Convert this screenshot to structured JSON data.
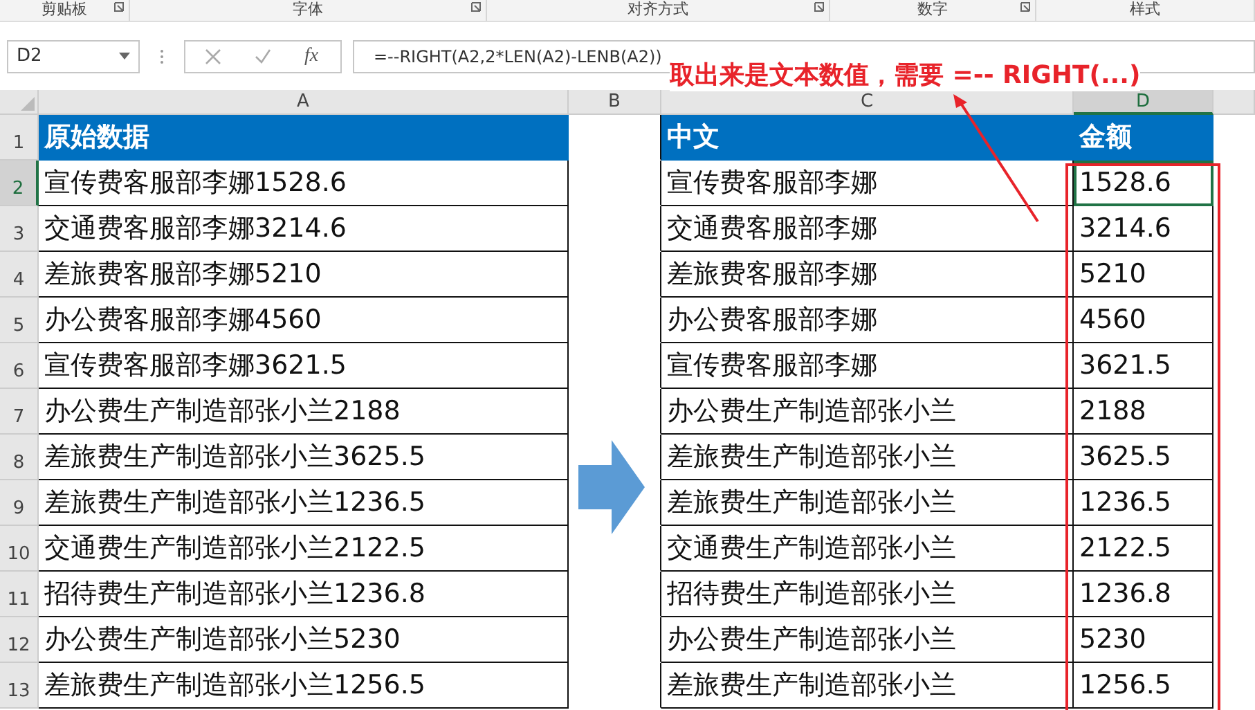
{
  "ribbon_groups": [
    "剪贴板",
    "字体",
    "对齐方式",
    "数字",
    "样式"
  ],
  "formula_bar": {
    "name_box": "D2",
    "function_icon": "fx",
    "formula": "=--RIGHT(A2,2*LEN(A2)-LENB(A2))"
  },
  "columns": [
    {
      "label": "A",
      "selected": false
    },
    {
      "label": "B",
      "selected": false
    },
    {
      "label": "C",
      "selected": false
    },
    {
      "label": "D",
      "selected": true
    }
  ],
  "header_row": {
    "number": "1",
    "a": "原始数据",
    "c": "中文",
    "d": "金额"
  },
  "rows": [
    {
      "number": "2",
      "selected": true,
      "a": "宣传费客服部李娜1528.6",
      "c": "宣传费客服部李娜",
      "d": "1528.6"
    },
    {
      "number": "3",
      "selected": false,
      "a": "交通费客服部李娜3214.6",
      "c": "交通费客服部李娜",
      "d": "3214.6"
    },
    {
      "number": "4",
      "selected": false,
      "a": "差旅费客服部李娜5210",
      "c": "差旅费客服部李娜",
      "d": "5210"
    },
    {
      "number": "5",
      "selected": false,
      "a": "办公费客服部李娜4560",
      "c": "办公费客服部李娜",
      "d": "4560"
    },
    {
      "number": "6",
      "selected": false,
      "a": "宣传费客服部李娜3621.5",
      "c": "宣传费客服部李娜",
      "d": "3621.5"
    },
    {
      "number": "7",
      "selected": false,
      "a": "办公费生产制造部张小兰2188",
      "c": "办公费生产制造部张小兰",
      "d": "2188"
    },
    {
      "number": "8",
      "selected": false,
      "a": "差旅费生产制造部张小兰3625.5",
      "c": "差旅费生产制造部张小兰",
      "d": "3625.5"
    },
    {
      "number": "9",
      "selected": false,
      "a": "差旅费生产制造部张小兰1236.5",
      "c": "差旅费生产制造部张小兰",
      "d": "1236.5"
    },
    {
      "number": "10",
      "selected": false,
      "a": "交通费生产制造部张小兰2122.5",
      "c": "交通费生产制造部张小兰",
      "d": "2122.5"
    },
    {
      "number": "11",
      "selected": false,
      "a": "招待费生产制造部张小兰1236.8",
      "c": "招待费生产制造部张小兰",
      "d": "1236.8"
    },
    {
      "number": "12",
      "selected": false,
      "a": "办公费生产制造部张小兰5230",
      "c": "办公费生产制造部张小兰",
      "d": "5230"
    },
    {
      "number": "13",
      "selected": false,
      "a": "差旅费生产制造部张小兰1256.5",
      "c": "差旅费生产制造部张小兰",
      "d": "1256.5"
    }
  ],
  "annotation": "取出来是文本数值，需要  =-- RIGHT(...)"
}
